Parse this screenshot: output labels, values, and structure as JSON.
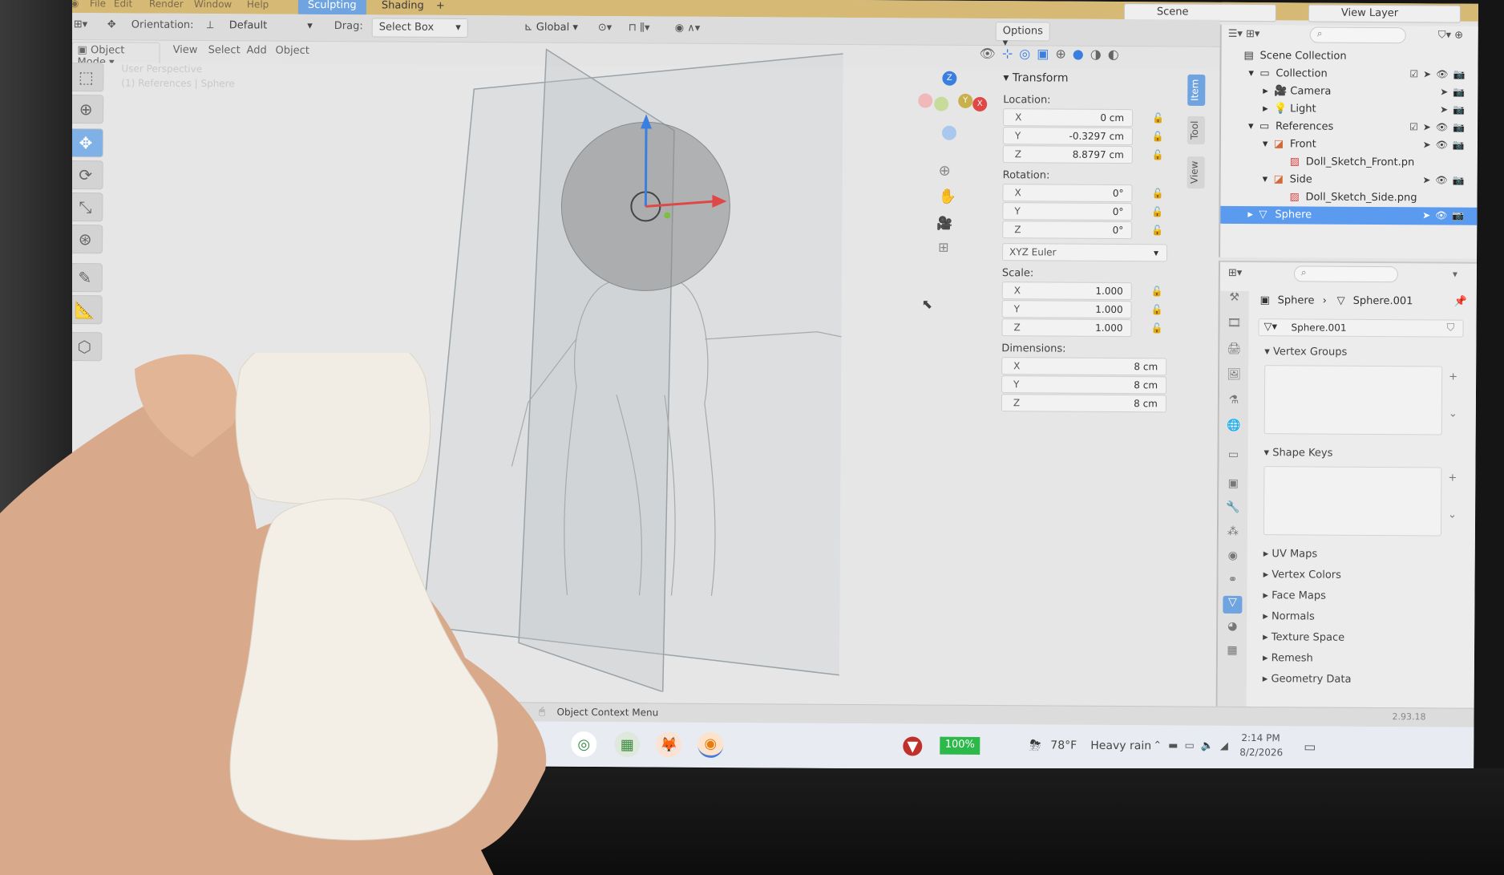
{
  "topbar": {
    "menus": [
      "File",
      "Edit",
      "Render",
      "Window",
      "Help"
    ],
    "tabs": [
      "Sculpting",
      "Shading"
    ],
    "active_tab": "Sculpting",
    "add_tab": "+",
    "scene": "Scene",
    "view_layer": "View Layer"
  },
  "header": {
    "orientation_label": "Orientation:",
    "orientation_value": "Default",
    "drag_label": "Drag:",
    "drag_value": "Select Box",
    "transform_orientation": "Global",
    "options": "Options"
  },
  "modebar": {
    "mode": "Object Mode",
    "menus": [
      "View",
      "Select",
      "Add",
      "Object"
    ]
  },
  "viewport": {
    "overlay_line1": "User Perspective",
    "overlay_line2": "(1) References | Sphere",
    "gizmo": {
      "z": "Z",
      "y": "Y",
      "x": "X"
    }
  },
  "npanel": {
    "section": "Transform",
    "location_label": "Location:",
    "location": [
      {
        "axis": "X",
        "value": "0 cm"
      },
      {
        "axis": "Y",
        "value": "-0.3297 cm"
      },
      {
        "axis": "Z",
        "value": "8.8797 cm"
      }
    ],
    "rotation_label": "Rotation:",
    "rotation": [
      {
        "axis": "X",
        "value": "0°"
      },
      {
        "axis": "Y",
        "value": "0°"
      },
      {
        "axis": "Z",
        "value": "0°"
      }
    ],
    "rotation_mode": "XYZ Euler",
    "scale_label": "Scale:",
    "scale": [
      {
        "axis": "X",
        "value": "1.000"
      },
      {
        "axis": "Y",
        "value": "1.000"
      },
      {
        "axis": "Z",
        "value": "1.000"
      }
    ],
    "dimensions_label": "Dimensions:",
    "dimensions": [
      {
        "axis": "X",
        "value": "8 cm"
      },
      {
        "axis": "Y",
        "value": "8 cm"
      },
      {
        "axis": "Z",
        "value": "8 cm"
      }
    ],
    "tabs": [
      "Item",
      "Tool",
      "View"
    ],
    "active_tab": "Item"
  },
  "outliner": {
    "rows": [
      {
        "label": "Scene Collection"
      },
      {
        "label": "Collection"
      },
      {
        "label": "Camera"
      },
      {
        "label": "Light"
      },
      {
        "label": "References"
      },
      {
        "label": "Front"
      },
      {
        "label": "Doll_Sketch_Front.pn"
      },
      {
        "label": "Side"
      },
      {
        "label": "Doll_Sketch_Side.png"
      },
      {
        "label": "Sphere"
      }
    ],
    "selected": "Sphere"
  },
  "properties": {
    "breadcrumb_object": "Sphere",
    "breadcrumb_sep": "›",
    "breadcrumb_data": "Sphere.001",
    "data_name": "Sphere.001",
    "sections": [
      "Vertex Groups",
      "Shape Keys",
      "UV Maps",
      "Vertex Colors",
      "Face Maps",
      "Normals",
      "Texture Space",
      "Remesh",
      "Geometry Data"
    ]
  },
  "statusbar": {
    "hint": "Object Context Menu",
    "version": "2.93.18"
  },
  "taskbar": {
    "battery": "100%",
    "weather_temp": "78°F",
    "weather_text": "Heavy rain",
    "time": "2:14 PM",
    "date": "8/2/2026"
  },
  "colors": {
    "accent": "#6fa4e0",
    "topbar": "#d7b976",
    "selected_row": "#5a9bf0",
    "axis_x": "#e04848",
    "axis_y": "#7fbf3f",
    "axis_z": "#3a7fe0"
  }
}
